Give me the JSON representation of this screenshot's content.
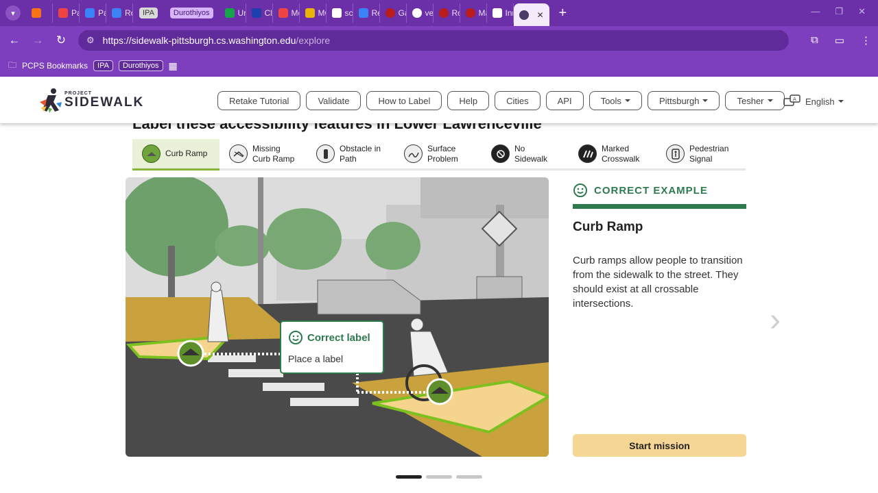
{
  "browser": {
    "tabs": [
      {
        "label": "",
        "color": "#f97316"
      },
      {
        "label": "Pa",
        "color": "#ef4444"
      },
      {
        "label": "Pa",
        "color": "#3b82f6"
      },
      {
        "label": "Rol",
        "color": "#3b82f6"
      },
      {
        "label": "IPA",
        "color": "#d9d9d9"
      },
      {
        "label": "Durothiyos",
        "color": "#d8b4fe"
      },
      {
        "label": "Unt",
        "color": "#16a34a"
      },
      {
        "label": "Cla",
        "color": "#1e40af"
      },
      {
        "label": "Mo",
        "color": "#ef4444"
      },
      {
        "label": "MC",
        "color": "#eab308"
      },
      {
        "label": "sc",
        "color": "#ffffff"
      },
      {
        "label": "Res",
        "color": "#3b82f6"
      },
      {
        "label": "Ga",
        "color": "#b91c1c"
      },
      {
        "label": "ver",
        "color": "#ffffff"
      },
      {
        "label": "Ro",
        "color": "#b91c1c"
      },
      {
        "label": "Ma",
        "color": "#b91c1c"
      },
      {
        "label": "Inn",
        "color": "#ffffff"
      }
    ],
    "url_host": "https://sidewalk-pittsburgh.cs.washington.edu",
    "url_path": "/explore",
    "bookmarks": {
      "folder": "PCPS Bookmarks",
      "b1": "IPA",
      "b2": "Durothiyos"
    }
  },
  "header": {
    "logo_small": "PROJECT",
    "logo_big": "SIDEWALK",
    "nav": {
      "retake": "Retake Tutorial",
      "validate": "Validate",
      "how": "How to Label",
      "help": "Help",
      "cities": "Cities",
      "api": "API",
      "tools": "Tools",
      "city": "Pittsburgh",
      "user": "Tesher"
    },
    "language": "English"
  },
  "main": {
    "heading": "Label these accessibility features in Lower Lawrenceville",
    "label_types": [
      {
        "l1": "Curb Ramp",
        "l2": ""
      },
      {
        "l1": "Missing",
        "l2": "Curb Ramp"
      },
      {
        "l1": "Obstacle in",
        "l2": "Path"
      },
      {
        "l1": "Surface",
        "l2": "Problem"
      },
      {
        "l1": "No",
        "l2": "Sidewalk"
      },
      {
        "l1": "Marked",
        "l2": "Crosswalk"
      },
      {
        "l1": "Pedestrian",
        "l2": "Signal"
      }
    ],
    "callout_title": "Correct label",
    "callout_sub": "Place a label",
    "example_header": "CORRECT EXAMPLE",
    "example_name": "Curb Ramp",
    "example_desc": "Curb ramps allow people to transition from the sidewalk to the street. They should exist at all crossable intersections.",
    "start_button": "Start mission",
    "colors": {
      "accent": "#2e7a4f",
      "start": "#f5d694",
      "selected_tab": "#e9f2d8"
    }
  }
}
